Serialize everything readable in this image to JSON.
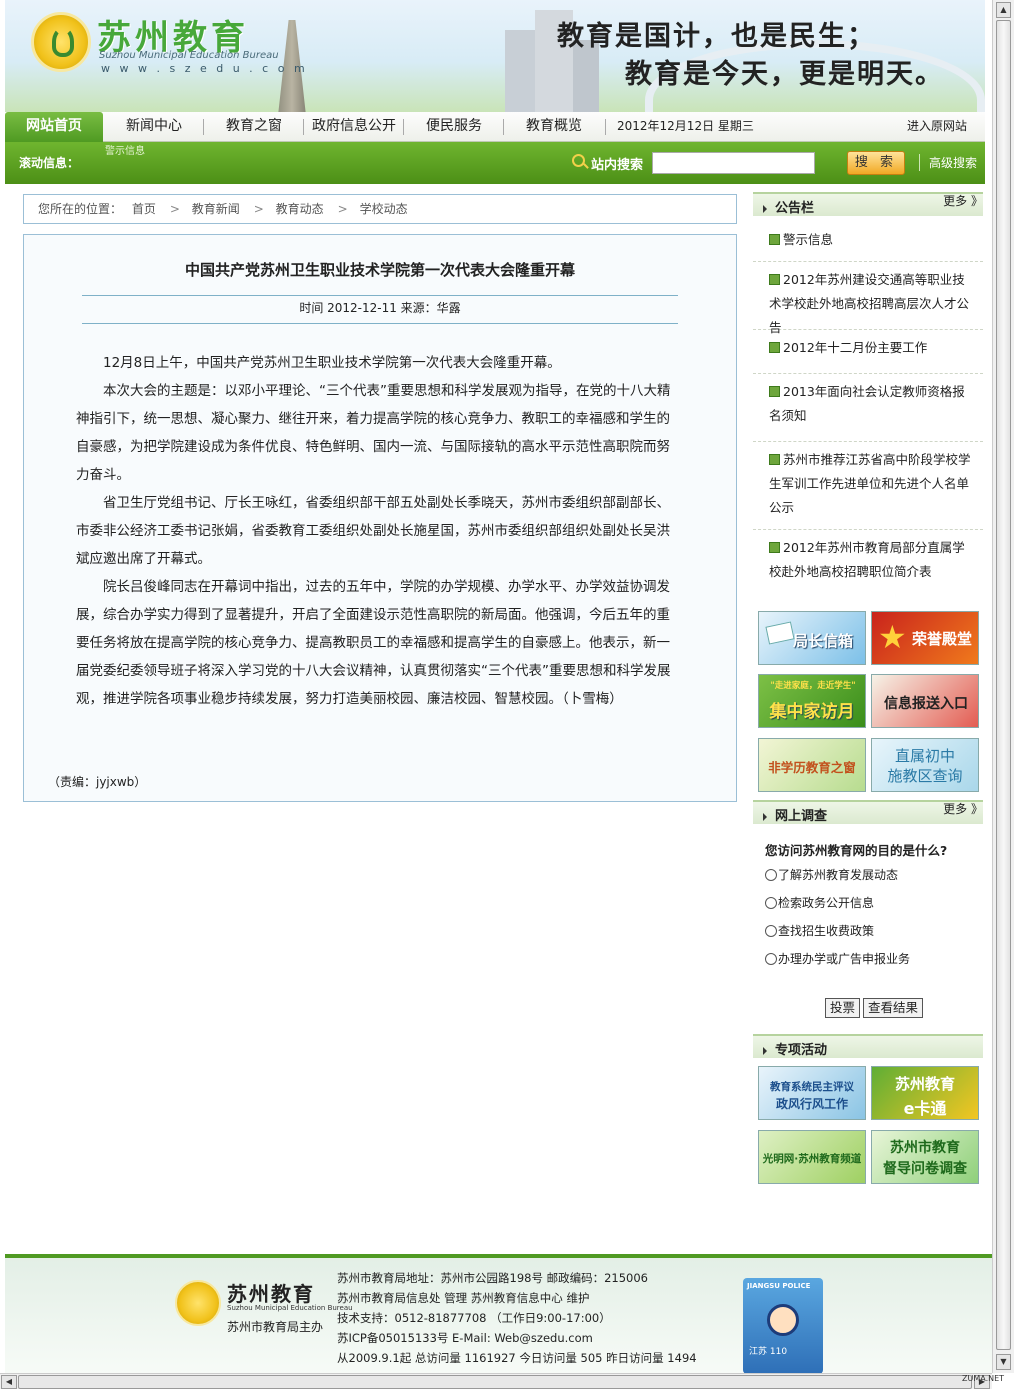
{
  "header": {
    "site_title": "苏州教育",
    "site_en": "Suzhou Municipal Education Bureau",
    "site_url": "w w w . s z e d u . c o m",
    "slogan_line1": "教育是国计，也是民生；",
    "slogan_line2": "教育是今天，更是明天。"
  },
  "nav": {
    "items": [
      {
        "label": "网站首页"
      },
      {
        "label": "新闻中心"
      },
      {
        "label": "教育之窗"
      },
      {
        "label": "政府信息公开"
      },
      {
        "label": "便民服务"
      },
      {
        "label": "教育概览"
      }
    ],
    "date": "2012年12月12日 星期三",
    "old_site": "进入原网站"
  },
  "bar": {
    "scroll_label": "滚动信息：",
    "scroll_text": "警示信息",
    "search_label": "站内搜索",
    "search_value": "",
    "search_button": "搜 索",
    "advanced_search": "高级搜索"
  },
  "breadcrumb": {
    "prefix": "您所在的位置：",
    "items": [
      "首页",
      "教育新闻",
      "教育动态",
      "学校动态"
    ]
  },
  "article": {
    "title": "中国共产党苏州卫生职业技术学院第一次代表大会隆重开幕",
    "meta": "时间 2012-12-11 来源：华露",
    "paragraphs": [
      "12月8日上午，中国共产党苏州卫生职业技术学院第一次代表大会隆重开幕。",
      "本次大会的主题是：以邓小平理论、“三个代表”重要思想和科学发展观为指导，在党的十八大精神指引下，统一思想、凝心聚力、继往开来，着力提高学院的核心竞争力、教职工的幸福感和学生的自豪感，为把学院建设成为条件优良、特色鲜明、国内一流、与国际接轨的高水平示范性高职院而努力奋斗。",
      "省卫生厅党组书记、厅长王咏红，省委组织部干部五处副处长季晓天，苏州市委组织部副部长、市委非公经济工委书记张娟，省委教育工委组织处副处长施星国，苏州市委组织部组织处副处长吴洪斌应邀出席了开幕式。",
      "院长吕俊峰同志在开幕词中指出，过去的五年中，学院的办学规模、办学水平、办学效益协调发展，综合办学实力得到了显著提升，开启了全面建设示范性高职院的新局面。他强调，今后五年的重要任务将放在提高学院的核心竞争力、提高教职员工的幸福感和提高学生的自豪感上。他表示，新一届党委纪委领导班子将深入学习党的十八大会议精神，认真贯彻落实“三个代表”重要思想和科学发展观，推进学院各项事业稳步持续发展，努力打造美丽校园、廉洁校园、智慧校园。（卜雪梅）"
    ],
    "editor": "（责编：jyjxwb）"
  },
  "notice": {
    "title": "公告栏",
    "more": "更多 》",
    "items": [
      "警示信息",
      "2012年苏州建设交通高等职业技术学校赴外地高校招聘高层次人才公告",
      "2012年十二月份主要工作",
      "2013年面向社会认定教师资格报名须知",
      "苏州市推荐江苏省高中阶段学校学生军训工作先进单位和先进个人名单公示",
      "2012年苏州市教育局部分直属学校赴外地高校招聘职位简介表"
    ]
  },
  "tiles": {
    "t1": "局长信箱",
    "t2": "荣誉殿堂",
    "t3a": "\"走进家庭，走近学生\"",
    "t3b": "集中家访月",
    "t4": "信息报送入口",
    "t5": "非学历教育之窗",
    "t6a": "直属初中",
    "t6b": "施教区查询"
  },
  "survey": {
    "title": "网上调查",
    "more": "更多 》",
    "question": "您访问苏州教育网的目的是什么?",
    "options": [
      "了解苏州教育发展动态",
      "检索政务公开信息",
      "查找招生收费政策",
      "办理办学或广告申报业务"
    ],
    "vote_button": "投票",
    "result_button": "查看结果"
  },
  "special": {
    "title": "专项活动",
    "t1a": "教育系统民主评议",
    "t1b": "政风行风工作",
    "t2a": "苏州教育",
    "t2b": "e卡通",
    "t3": "光明网·苏州教育频道",
    "t4a": "苏州市教育",
    "t4b": "督导问卷调查"
  },
  "footer": {
    "title": "苏州教育",
    "en": "Suzhou Municipal Education Bureau",
    "host": "苏州市教育局主办",
    "lines": [
      "苏州市教育局地址：苏州市公园路198号 邮政编码：215006",
      "苏州市教育局信息处 管理 苏州教育信息中心 维护",
      "技术支持：0512-81877708 （工作日9:00-17:00）",
      "苏ICP备05015133号 E-Mail: Web@szedu.com",
      "从2009.9.1起 总访问量 1161927 今日访问量 505 昨日访问量 1494"
    ],
    "police_tag": "JIANGSU POLICE",
    "police_sub": "江苏 110"
  },
  "watermark": "ZUMA.NET",
  "colors": {
    "green": "#4f9a22",
    "border_blue": "#9bbfd6"
  }
}
